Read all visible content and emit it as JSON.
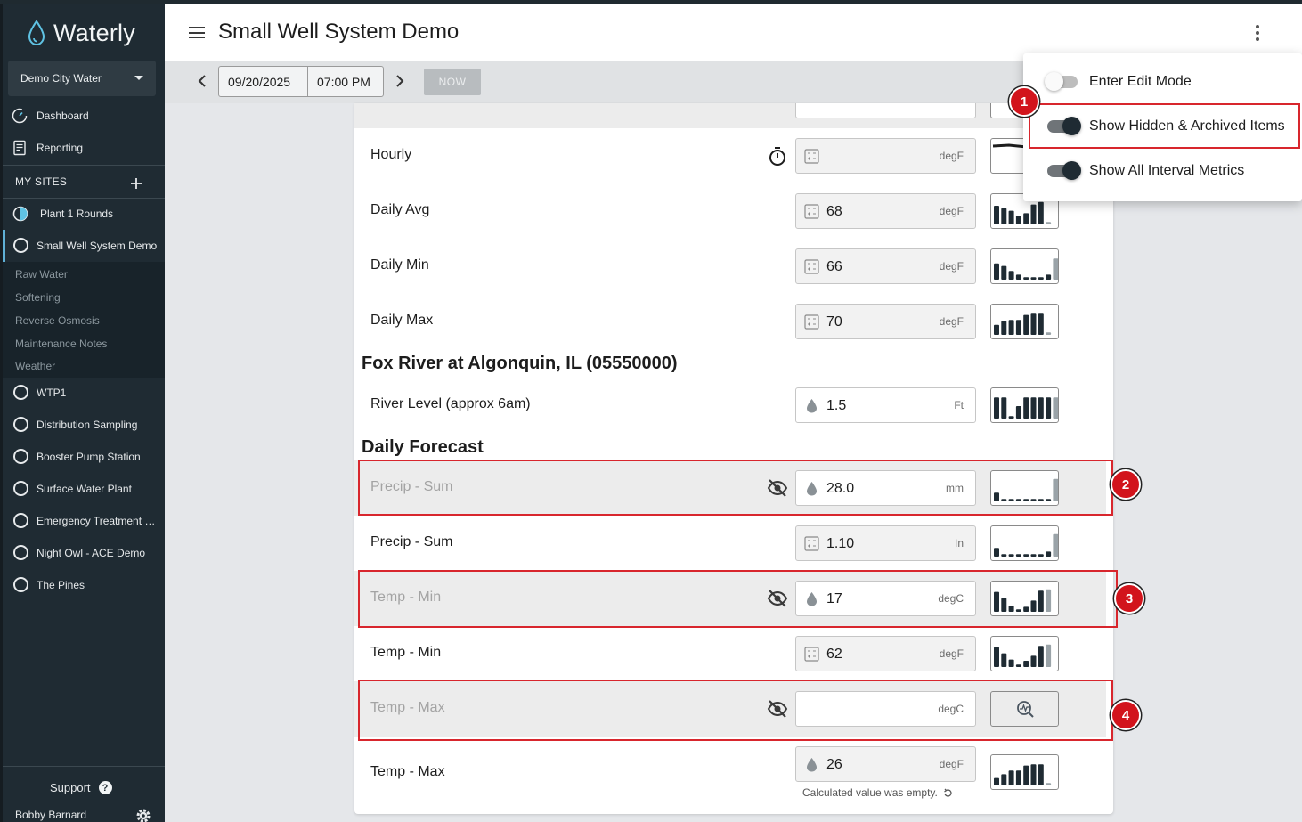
{
  "app": {
    "name": "Waterly",
    "org": "Demo City Water"
  },
  "nav": {
    "dashboard": "Dashboard",
    "reporting": "Reporting"
  },
  "my_sites": {
    "header": "MY SITES",
    "sites": [
      {
        "label": "Plant 1 Rounds"
      },
      {
        "label": "Small Well System Demo"
      }
    ],
    "sub_items": [
      "Raw Water",
      "Softening",
      "Reverse Osmosis",
      "Maintenance Notes",
      "Weather"
    ],
    "other_sites": [
      "WTP1",
      "Distribution Sampling",
      "Booster Pump Station",
      "Surface Water Plant",
      "Emergency Treatment Plant",
      "Night Owl - ACE Demo",
      "The Pines"
    ]
  },
  "footer": {
    "support": "Support",
    "user": "Bobby Barnard"
  },
  "header": {
    "title": "Small Well System Demo"
  },
  "toolbar": {
    "date": "09/20/2025",
    "time": "07:00 PM",
    "now": "NOW"
  },
  "rows": [
    {
      "name": "Hourly",
      "value": "",
      "unit": "degF"
    },
    {
      "name": "Daily Avg",
      "value": "68",
      "unit": "degF",
      "spark": [
        0.75,
        0.65,
        0.55,
        0.35,
        0.45,
        0.8,
        0.9,
        0.1
      ]
    },
    {
      "name": "Daily Min",
      "value": "66",
      "unit": "degF",
      "spark": [
        0.65,
        0.55,
        0.35,
        0.2,
        0.1,
        0.1,
        0.1,
        0.2,
        0.85
      ]
    },
    {
      "name": "Daily Max",
      "value": "70",
      "unit": "degF",
      "spark": [
        0.4,
        0.55,
        0.6,
        0.6,
        0.8,
        0.85,
        0.85,
        0.1
      ]
    }
  ],
  "sections": {
    "river": "Fox River at Algonquin, IL (05550000)",
    "forecast": "Daily Forecast"
  },
  "river_row": {
    "name": "River Level (approx 6am)",
    "value": "1.5",
    "unit": "Ft",
    "spark": [
      0.85,
      0.85,
      0.1,
      0.5,
      0.85,
      0.85,
      0.85,
      0.85,
      0.85
    ]
  },
  "forecast_rows": [
    {
      "name": "Precip - Sum",
      "value": "28.0",
      "unit": "mm",
      "hidden": true,
      "spark": [
        0.35,
        0.1,
        0.1,
        0.1,
        0.1,
        0.1,
        0.1,
        0.1,
        0.9
      ]
    },
    {
      "name": "Precip - Sum",
      "value": "1.10",
      "unit": "In",
      "hidden": false,
      "spark": [
        0.35,
        0.1,
        0.1,
        0.1,
        0.1,
        0.1,
        0.1,
        0.2,
        0.9
      ]
    },
    {
      "name": "Temp - Min",
      "value": "17",
      "unit": "degC",
      "hidden": true,
      "spark": [
        0.8,
        0.55,
        0.25,
        0.1,
        0.2,
        0.45,
        0.85,
        0.9
      ]
    },
    {
      "name": "Temp - Min",
      "value": "62",
      "unit": "degF",
      "hidden": false,
      "spark": [
        0.8,
        0.55,
        0.3,
        0.1,
        0.25,
        0.45,
        0.85,
        0.9
      ]
    },
    {
      "name": "Temp - Max",
      "value": "",
      "unit": "degC",
      "hidden": true
    },
    {
      "name": "Temp - Max",
      "value": "26",
      "unit": "degF",
      "hidden": false,
      "spark": [
        0.3,
        0.45,
        0.6,
        0.6,
        0.8,
        0.85,
        0.85,
        0.1
      ]
    }
  ],
  "calc_note": "Calculated value was empty.",
  "menu": {
    "edit_mode": "Enter Edit Mode",
    "show_hidden": "Show Hidden & Archived Items",
    "show_interval": "Show All Interval Metrics",
    "edit_mode_on": false,
    "show_hidden_on": true,
    "show_interval_on": true
  },
  "badges": [
    "1",
    "2",
    "3",
    "4"
  ],
  "colors": {
    "sidebar": "#1f2b33",
    "accent_red": "#d2141c",
    "spark_bar": "#1f2b33",
    "spark_last": "#9aa3a8"
  }
}
